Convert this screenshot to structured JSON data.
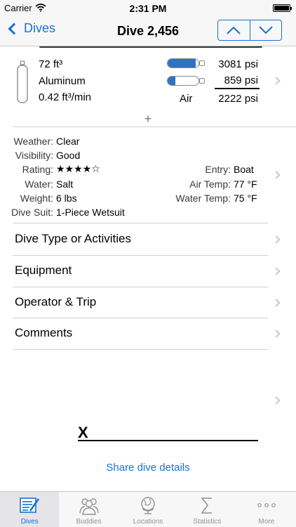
{
  "status_bar": {
    "carrier": "Carrier",
    "time": "2:31 PM"
  },
  "nav": {
    "back_label": "Dives",
    "title": "Dive 2,456",
    "up_icon": "chevron-up-icon",
    "down_icon": "chevron-down-icon",
    "accent_color": "#1a6fd8"
  },
  "tank": {
    "volume": "72 ft³",
    "material": "Aluminum",
    "sac_rate": "0.42 ft³/min",
    "start_pressure": "3081 psi",
    "end_pressure": "859 psi",
    "gas": "Air",
    "used_pressure": "2222 psi",
    "start_fill": 0.92,
    "end_fill": 0.26,
    "gauge_color": "#2f72c4"
  },
  "conditions": {
    "weather_label": "Weather:",
    "weather": "Clear",
    "visibility_label": "Visibility:",
    "visibility": "Good",
    "rating_label": "Rating:",
    "rating": "★★★★☆",
    "water_label": "Water:",
    "water": "Salt",
    "weight_label": "Weight:",
    "weight": "6 lbs",
    "suit_label": "Dive Suit:",
    "suit": "1-Piece Wetsuit",
    "entry_label": "Entry:",
    "entry": "Boat",
    "air_temp_label": "Air Temp:",
    "air_temp": "77 °F",
    "water_temp_label": "Water Temp:",
    "water_temp": "75 °F"
  },
  "menu": [
    {
      "label": "Dive Type or Activities"
    },
    {
      "label": "Equipment"
    },
    {
      "label": "Operator & Trip"
    },
    {
      "label": "Comments"
    }
  ],
  "signature": {
    "mark": "X"
  },
  "share_label": "Share dive details",
  "tabs": [
    {
      "label": "Dives",
      "icon": "logbook-icon",
      "active": true
    },
    {
      "label": "Buddies",
      "icon": "buddies-icon",
      "active": false
    },
    {
      "label": "Locations",
      "icon": "globe-icon",
      "active": false
    },
    {
      "label": "Statistics",
      "icon": "sigma-icon",
      "active": false
    },
    {
      "label": "More",
      "icon": "more-dots-icon",
      "active": false
    }
  ]
}
